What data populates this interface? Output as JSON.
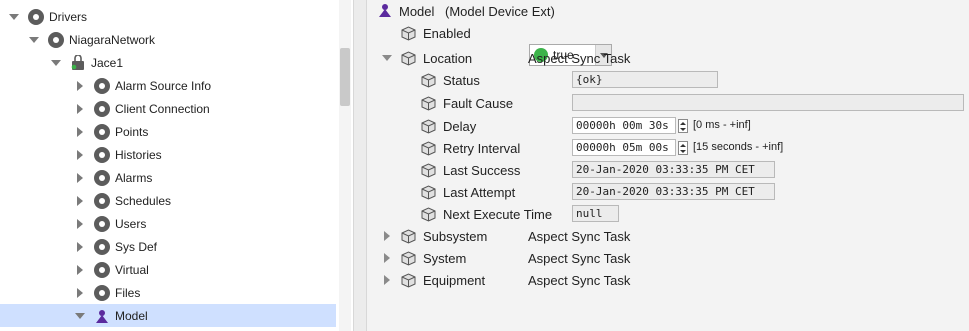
{
  "tree": {
    "items": [
      {
        "label": "Drivers",
        "icon": "drivers-icon"
      },
      {
        "label": "NiagaraNetwork",
        "icon": "network-icon"
      },
      {
        "label": "Jace1",
        "icon": "jace-station-icon"
      },
      {
        "label": "Alarm Source Info",
        "icon": "alarm-source-icon"
      },
      {
        "label": "Client Connection",
        "icon": "client-connection-icon"
      },
      {
        "label": "Points",
        "icon": "points-icon"
      },
      {
        "label": "Histories",
        "icon": "histories-icon"
      },
      {
        "label": "Alarms",
        "icon": "alarms-icon"
      },
      {
        "label": "Schedules",
        "icon": "schedules-icon"
      },
      {
        "label": "Users",
        "icon": "users-icon"
      },
      {
        "label": "Sys Def",
        "icon": "sysdef-icon"
      },
      {
        "label": "Virtual",
        "icon": "virtual-icon"
      },
      {
        "label": "Files",
        "icon": "files-icon"
      },
      {
        "label": "Model",
        "icon": "model-icon"
      }
    ]
  },
  "sheet": {
    "header": {
      "name": "Model",
      "type": "(Model Device Ext)"
    },
    "enabled": {
      "label": "Enabled",
      "value": "true",
      "status_color": "#3cb34a"
    },
    "location": {
      "label": "Location",
      "type": "Aspect Sync Task"
    },
    "status": {
      "label": "Status",
      "value": "{ok}"
    },
    "fault_cause": {
      "label": "Fault Cause",
      "value": ""
    },
    "delay": {
      "label": "Delay",
      "value": "00000h 00m 30s",
      "range": "[0 ms - +inf]"
    },
    "retry_interval": {
      "label": "Retry Interval",
      "value": "00000h 05m 00s",
      "range": "[15 seconds - +inf]"
    },
    "last_success": {
      "label": "Last Success",
      "value": "20-Jan-2020 03:33:35 PM CET"
    },
    "last_attempt": {
      "label": "Last Attempt",
      "value": "20-Jan-2020 03:33:35 PM CET"
    },
    "next_execute_time": {
      "label": "Next Execute Time",
      "value": "null"
    },
    "subsystem": {
      "label": "Subsystem",
      "type": "Aspect Sync Task"
    },
    "system": {
      "label": "System",
      "type": "Aspect Sync Task"
    },
    "equipment": {
      "label": "Equipment",
      "type": "Aspect Sync Task"
    }
  },
  "colors": {
    "selection": "#cfe0ff",
    "accent_green": "#3cb34a",
    "model_icon": "#5b2a9e"
  }
}
